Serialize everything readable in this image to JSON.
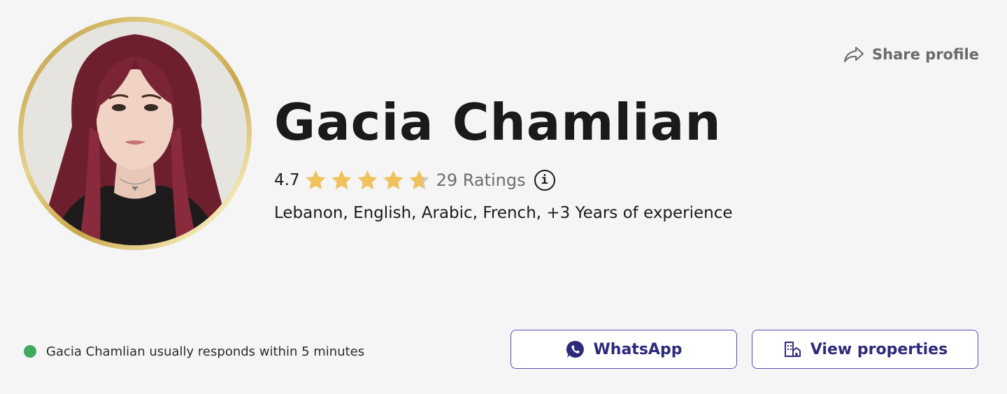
{
  "profile": {
    "name": "Gacia Chamlian",
    "rating": "4.7",
    "stars_value": 4.7,
    "stars_max": 5,
    "ratings_count": "29 Ratings",
    "details": "Lebanon, English, Arabic, French, +3 Years of experience",
    "response_text": "Gacia Chamlian usually responds within 5 minutes"
  },
  "actions": {
    "share_label": "Share profile",
    "whatsapp_label": "WhatsApp",
    "properties_label": "View properties"
  },
  "icons": {
    "share": "share-arrow-icon",
    "info": "info-icon",
    "whatsapp": "whatsapp-icon",
    "properties": "building-icon",
    "star": "star-icon"
  },
  "colors": {
    "star": "#f1c25c",
    "star_empty": "#c9c9c9",
    "online": "#3eaa5e",
    "button_border": "#5a4fb0",
    "button_text": "#2d2a7a",
    "avatar_ring": "#c9a749"
  }
}
